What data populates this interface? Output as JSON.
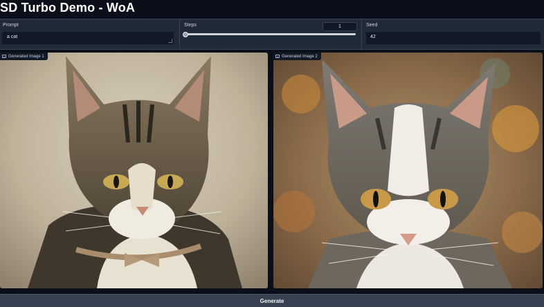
{
  "app": {
    "title": "SD Turbo Demo - WoA"
  },
  "controls": {
    "prompt": {
      "label": "Prompt",
      "value": "a cat"
    },
    "steps": {
      "label": "Steps",
      "value": "1",
      "slider_level": 0.0
    },
    "seed": {
      "label": "Seed",
      "value": "42"
    }
  },
  "gallery": {
    "image1": {
      "label": "Generated Image 1",
      "icon": "image-icon"
    },
    "image2": {
      "label": "Generated Image 2",
      "icon": "image-icon"
    }
  },
  "actions": {
    "generate_label": "Generate"
  },
  "colors": {
    "background": "#0b0f19",
    "panel": "#1f2937",
    "button": "#374151"
  }
}
